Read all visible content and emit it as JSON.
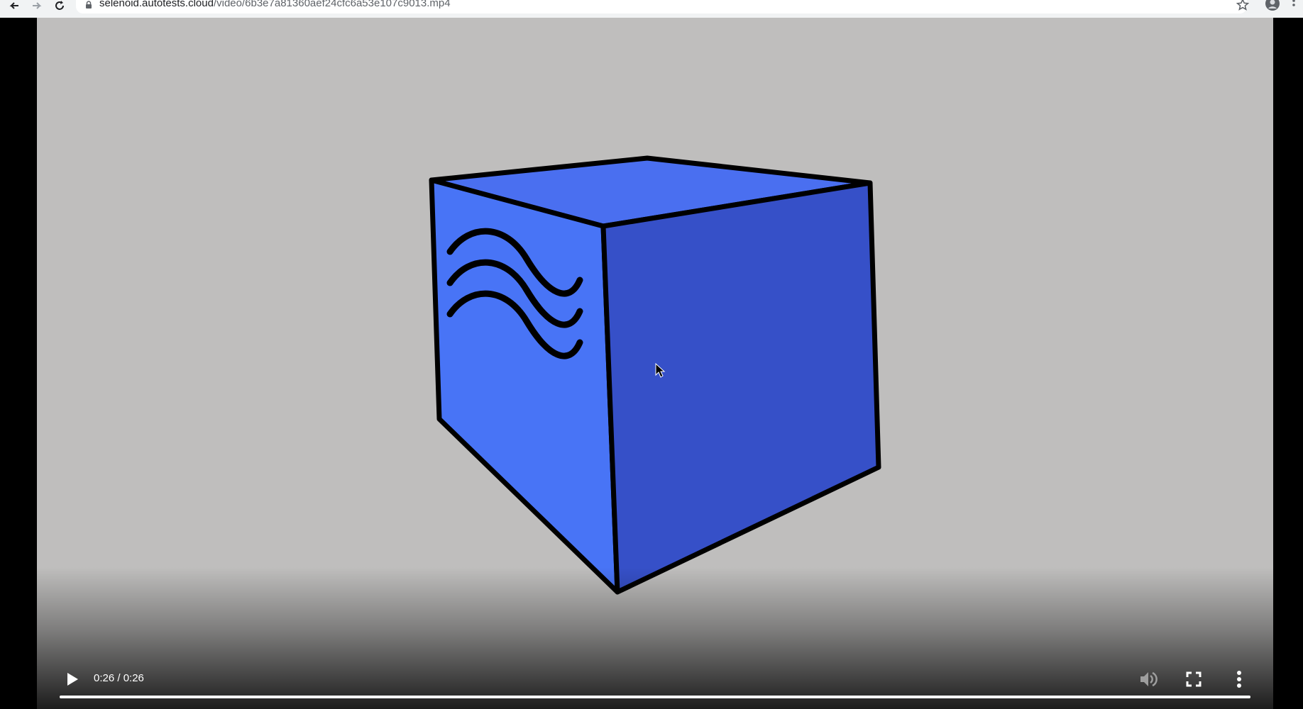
{
  "browser": {
    "url_domain": "selenoid.autotests.cloud",
    "url_path": "/video/6b3e7a81360aef24cfc6a53e107c9013.mp4"
  },
  "video": {
    "current_time": "0:26",
    "duration": "0:26",
    "time_label": "0:26 / 0:26",
    "progress": 1.0,
    "state": "paused"
  },
  "icons": {
    "back": "arrow-left-icon",
    "forward": "arrow-right-icon",
    "reload": "reload-icon",
    "lock": "lock-icon",
    "bookmark": "star-icon",
    "profile": "profile-icon",
    "menu": "kebab-menu-icon",
    "play": "play-icon",
    "volume": "volume-icon",
    "fullscreen": "fullscreen-icon",
    "more": "more-vertical-icon"
  },
  "colors": {
    "background": "#bfbebd",
    "cube_top": "#4a6ff0",
    "cube_left": "#4874f6",
    "cube_right": "#3650c8",
    "outline": "#000000"
  }
}
